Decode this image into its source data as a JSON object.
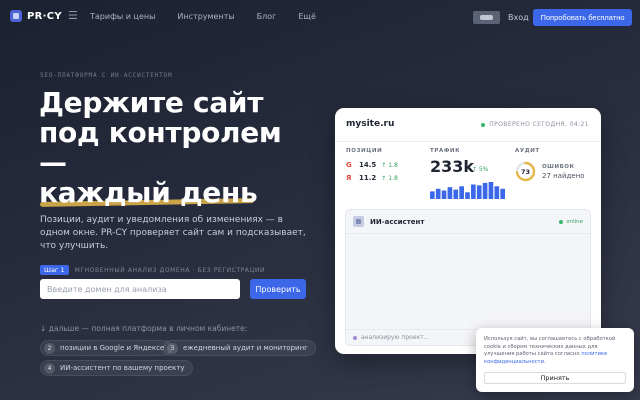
{
  "header": {
    "logo_text": "PR·CY",
    "nav": [
      "Тарифы и цены",
      "Инструменты",
      "Блог",
      "Ещё"
    ],
    "login_label": "Вход",
    "cta_label": "Попробовать бесплатно"
  },
  "hero": {
    "eyebrow": "SEO-ПЛАТФОРМА С ИИ-АССИСТЕНТОМ",
    "headline": [
      "Держите сайт",
      "под контролем",
      "—",
      "каждый день"
    ],
    "lead": "Позиции, аудит и уведомления об изменениях — в одном окне. PR-CY проверяет сайт сам и подсказывает, что улучшить.",
    "step_badge": "Шаг 1",
    "step_note": "МГНОВЕННЫЙ АНАЛИЗ ДОМЕНА · БЕЗ РЕГИСТРАЦИИ",
    "domain_placeholder": "Введите домен для анализа",
    "check_label": "Проверить",
    "more_note": "↓ дальше — полная платформа в личном кабинете:",
    "features": [
      {
        "num": "2",
        "label": "позиции в Google и Яндексе"
      },
      {
        "num": "3",
        "label": "ежедневный аудит и мониторинг"
      },
      {
        "num": "4",
        "label": "ИИ-ассистент по вашему проекту"
      }
    ]
  },
  "dashboard": {
    "site": "mysite.ru",
    "status": "ПРОВЕРЕНО СЕГОДНЯ, 04:21",
    "positions_title": "ПОЗИЦИИ",
    "positions": [
      {
        "engine": "G",
        "value": "14.5",
        "delta": "↑ 1.8",
        "color": "#e04a3a"
      },
      {
        "engine": "Я",
        "value": "11.2",
        "delta": "↑ 1.8",
        "color": "#e04a3a"
      }
    ],
    "traffic_title": "ТРАФИК",
    "traffic_value": "233k",
    "traffic_delta": "↑ 5%",
    "traffic_bars": [
      0.45,
      0.6,
      0.5,
      0.7,
      0.55,
      0.75,
      0.4,
      0.85,
      0.8,
      0.95,
      1.0,
      0.75,
      0.6
    ],
    "audit_title": "АУДИТ",
    "audit_score": "73",
    "audit_score_fraction": 0.73,
    "errors_label": "ОШИБОК",
    "errors_found": "27 найдено",
    "ai_title": "ИИ-ассистент",
    "ai_status": "online",
    "ai_typing": "анализирую проект..."
  },
  "cookie": {
    "text": "Используя сайт, вы соглашаетесь с обработкой cookie и сбором технических данных для улучшения работы сайта согласно",
    "link": "политике конфиденциальности.",
    "accept_label": "Принять"
  },
  "colors": {
    "accent": "#3b67e8",
    "success": "#33b86b",
    "highlight": "#e6b84a"
  }
}
